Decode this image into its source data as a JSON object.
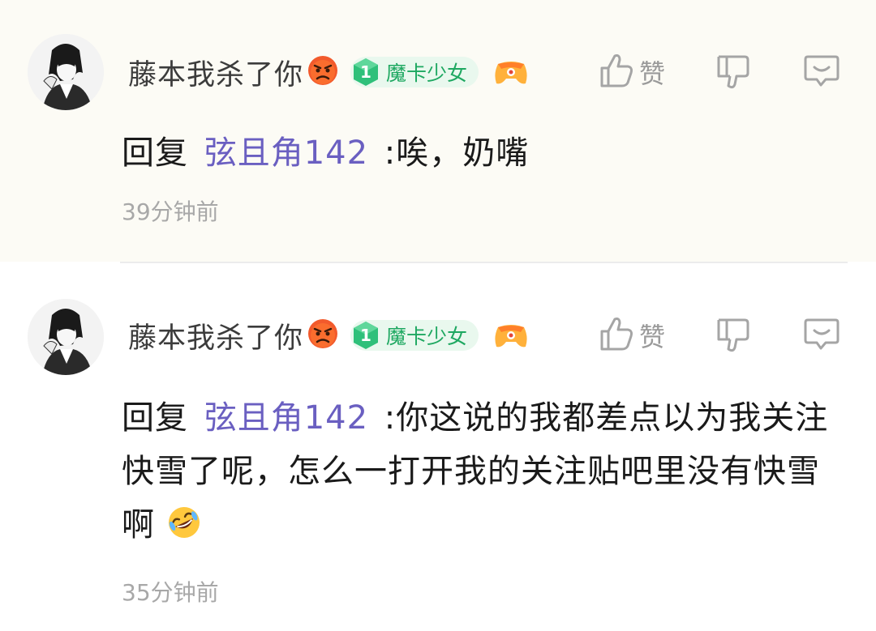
{
  "comments": [
    {
      "username": "藤本我杀了你",
      "level": "1",
      "level_title": "魔卡少女",
      "like_label": "赞",
      "reply_prefix": "回复",
      "reply_target": "弦且角142",
      "text": ":唉，奶嘴",
      "time": "39分钟前"
    },
    {
      "username": "藤本我杀了你",
      "level": "1",
      "level_title": "魔卡少女",
      "like_label": "赞",
      "reply_prefix": "回复",
      "reply_target": "弦且角142",
      "text": ":你这说的我都差点以为我关注快雪了呢，怎么一打开我的关注贴吧里没有快雪啊",
      "time": "35分钟前"
    }
  ],
  "colors": {
    "reply_target": "#6a5fc1",
    "level_badge": "#1ea861",
    "highlight_bg": "#fcfbf5"
  },
  "icons": [
    "avatar",
    "angry-face-emoji",
    "level-gem-icon",
    "game-controller-icon",
    "thumbs-up-icon",
    "thumbs-down-icon",
    "reply-bubble-icon",
    "rofl-emoji"
  ]
}
